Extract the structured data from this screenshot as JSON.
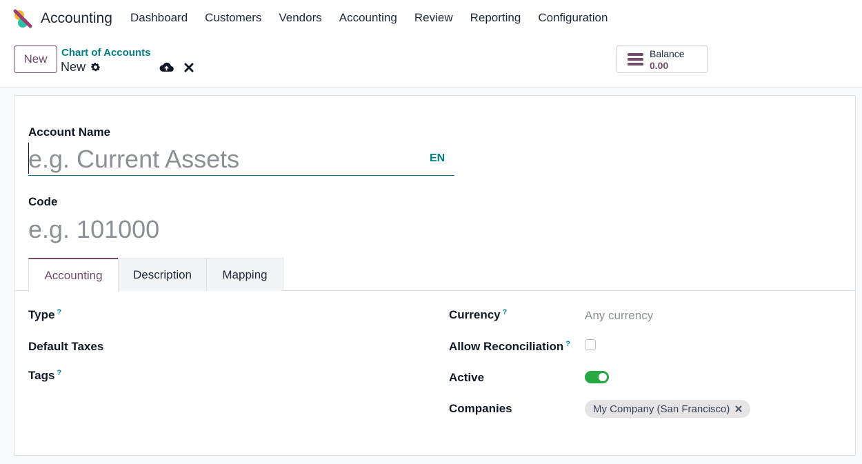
{
  "app": {
    "name": "Accounting"
  },
  "nav": {
    "items": [
      {
        "label": "Dashboard"
      },
      {
        "label": "Customers"
      },
      {
        "label": "Vendors"
      },
      {
        "label": "Accounting"
      },
      {
        "label": "Review"
      },
      {
        "label": "Reporting"
      },
      {
        "label": "Configuration"
      }
    ]
  },
  "control": {
    "new_label": "New",
    "breadcrumb": "Chart of Accounts",
    "record_name": "New",
    "balance_label": "Balance",
    "balance_value": "0.00"
  },
  "form": {
    "account_name_label": "Account Name",
    "account_name_placeholder": "e.g. Current Assets",
    "account_name_value": "",
    "lang_code": "EN",
    "code_label": "Code",
    "code_placeholder": "e.g. 101000",
    "code_value": ""
  },
  "tabs": [
    {
      "label": "Accounting",
      "active": true
    },
    {
      "label": "Description",
      "active": false
    },
    {
      "label": "Mapping",
      "active": false
    }
  ],
  "fields_left": {
    "type_label": "Type",
    "default_taxes_label": "Default Taxes",
    "tags_label": "Tags"
  },
  "fields_right": {
    "currency_label": "Currency",
    "currency_placeholder": "Any currency",
    "allow_reconciliation_label": "Allow Reconciliation",
    "allow_reconciliation_checked": false,
    "active_label": "Active",
    "active_on": true,
    "companies_label": "Companies",
    "companies": [
      "My Company (San Francisco)"
    ]
  },
  "help_marker": "?",
  "colors": {
    "brand": "#714b67",
    "accent": "#017e84",
    "toggle_on": "#28a745"
  }
}
